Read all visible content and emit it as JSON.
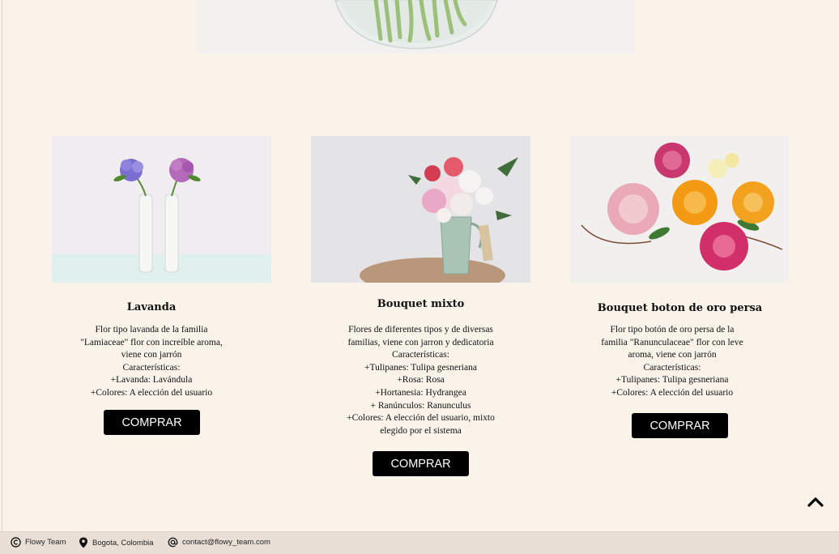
{
  "hero": {
    "image": "flower-vase-hero"
  },
  "products": [
    {
      "title": "Lavanda",
      "image": "hydrangea-white-vases",
      "description": [
        "Flor tipo lavanda de la familia",
        "\"Lamiaceae\" flor con increíble aroma,",
        "viene con jarrón",
        "Características:",
        "+Lavanda: Lavándula",
        "+Colores: A elección del usuario"
      ],
      "button": "COMPRAR"
    },
    {
      "title": "Bouquet mixto",
      "image": "mixed-bouquet-pitcher",
      "description": [
        "Flores de diferentes tipos y de diversas",
        "familias, viene con jarron y dedicatoria",
        "Características:",
        "+Tulipanes: Tulipa gesneriana",
        "+Rosa: Rosa",
        "+Hortanesia: Hydrangea",
        "+ Ranúnculos: Ranunculus",
        "+Colores: A elección del usuario, mixto",
        "elegido por el sistema"
      ],
      "button": "COMPRAR"
    },
    {
      "title": "Bouquet boton de oro persa",
      "image": "ranunculus-bouquet",
      "description": [
        "Flor tipo botón de oro persa de la",
        "familia \"Ranunculaceae\" flor con leve",
        "aroma, viene con jarrón",
        "Características:",
        "+Tulipanes: Tulipa gesneriana",
        "+Colores: A elección del usuario"
      ],
      "button": "COMPRAR"
    }
  ],
  "back_to_top_icon": "chevron-up-icon",
  "footer": {
    "copyright": "Flowy Team",
    "location": "Bogota, Colombia",
    "email": "contact@flowy_team.com"
  }
}
